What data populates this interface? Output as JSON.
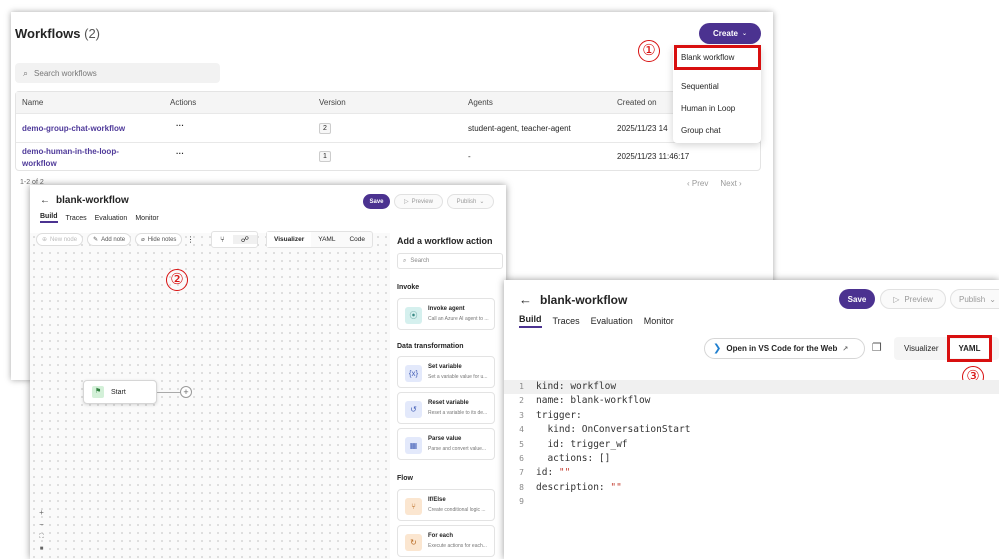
{
  "list_screen": {
    "title": "Workflows",
    "count": "(2)",
    "create_label": "Create",
    "search_placeholder": "Search workflows",
    "columns": [
      "Name",
      "Actions",
      "Version",
      "Agents",
      "Created on"
    ],
    "rows": [
      {
        "name": "demo-group-chat-workflow",
        "actions": "···",
        "version": "2",
        "agents": "student-agent, teacher-agent",
        "created": "2025/11/23 14"
      },
      {
        "name_line1": "demo-human-in-the-loop-",
        "name_line2": "workflow",
        "actions": "···",
        "version": "1",
        "agents": "-",
        "created": "2025/11/23 11:46:17"
      }
    ],
    "pagination": "1-2 of 2",
    "prev_label": "Prev",
    "next_label": "Next",
    "dropdown": [
      "Blank workflow",
      "Sequential",
      "Human in Loop",
      "Group chat"
    ]
  },
  "builder_screen": {
    "title": "blank-workflow",
    "tabs": [
      "Build",
      "Traces",
      "Evaluation",
      "Monitor"
    ],
    "save_label": "Save",
    "preview_label": "Preview",
    "publish_label": "Publish",
    "toolbar": {
      "new_node": "New node",
      "add_note": "Add note",
      "hide_notes": "Hide notes"
    },
    "view_tabs": [
      "Visualizer",
      "YAML",
      "Code"
    ],
    "start_node": "Start",
    "panel": {
      "title": "Add a workflow action",
      "search_placeholder": "Search",
      "sections": [
        {
          "label": "Invoke",
          "items": [
            {
              "title": "Invoke agent",
              "desc": "Call an Azure AI agent to ..."
            }
          ]
        },
        {
          "label": "Data transformation",
          "items": [
            {
              "title": "Set variable",
              "desc": "Set a variable value for u..."
            },
            {
              "title": "Reset variable",
              "desc": "Reset a variable to its de..."
            },
            {
              "title": "Parse value",
              "desc": "Parse and convert value..."
            }
          ]
        },
        {
          "label": "Flow",
          "items": [
            {
              "title": "If/Else",
              "desc": "Create conditional logic ..."
            },
            {
              "title": "For each",
              "desc": "Execute actions for each..."
            }
          ]
        }
      ]
    }
  },
  "yaml_screen": {
    "title": "blank-workflow",
    "tabs": [
      "Build",
      "Traces",
      "Evaluation",
      "Monitor"
    ],
    "save_label": "Save",
    "preview_label": "Preview",
    "publish_label": "Publish",
    "vscode_label": "Open in VS Code for the Web",
    "view_tabs": [
      "Visualizer",
      "YAML"
    ],
    "yaml_lines": [
      {
        "n": "1",
        "text": "kind: workflow"
      },
      {
        "n": "2",
        "text": "name: blank-workflow"
      },
      {
        "n": "3",
        "text": "trigger:"
      },
      {
        "n": "4",
        "text": "  kind: OnConversationStart"
      },
      {
        "n": "5",
        "text": "  id: trigger_wf"
      },
      {
        "n": "6",
        "text": "  actions: []"
      },
      {
        "n": "7",
        "text": "id: "
      },
      {
        "n": "8",
        "text": "description: "
      },
      {
        "n": "9",
        "text": ""
      }
    ],
    "empty_string": "\"\""
  },
  "markers": [
    "①",
    "②",
    "③"
  ],
  "colors": {
    "accent": "#4b3290",
    "link": "#4f3a9a",
    "highlight": "#d80f0f"
  }
}
